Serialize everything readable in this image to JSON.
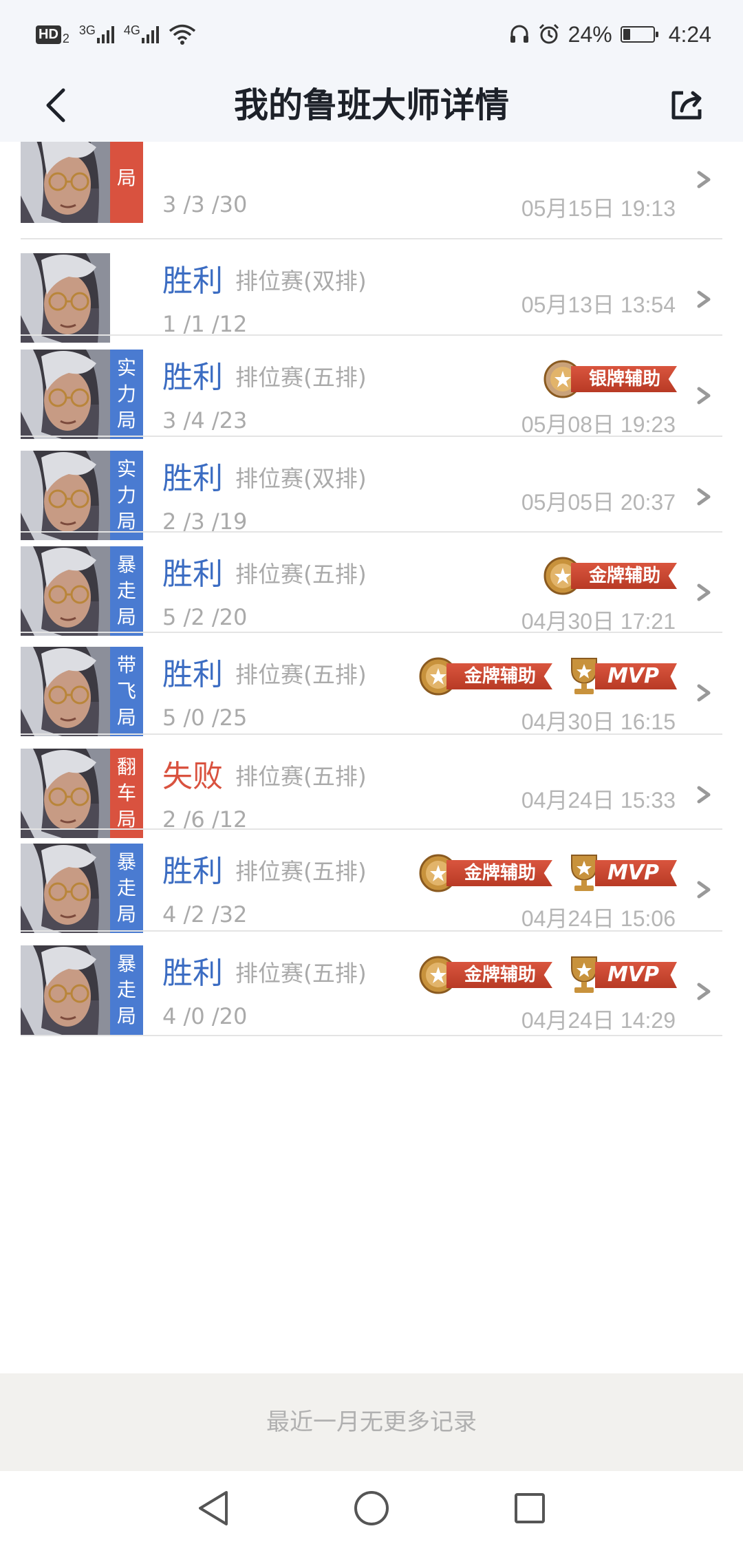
{
  "status_bar": {
    "hd_label": "HD",
    "hd_sub": "2",
    "net1": "3G",
    "net2": "4G",
    "battery_percent": "24%",
    "battery_level": 0.24,
    "time": "4:24"
  },
  "header": {
    "title": "我的鲁班大师详情"
  },
  "rows": [
    {
      "tag": "局",
      "tag_color": "red",
      "result": "",
      "result_type": "win",
      "mode": "",
      "kda": "3 /3 /30",
      "time": "05月15日 19:13",
      "badges": [],
      "partial": true
    },
    {
      "tag": "",
      "tag_color": "none",
      "result": "胜利",
      "result_type": "win",
      "mode": "排位赛(双排)",
      "kda": "1 /1 /12",
      "time": "05月13日 13:54",
      "badges": []
    },
    {
      "tag": "实力局",
      "tag_color": "blue",
      "result": "胜利",
      "result_type": "win",
      "mode": "排位赛(五排)",
      "kda": "3 /4 /23",
      "time": "05月08日 19:23",
      "badges": [
        {
          "kind": "medal",
          "label": "银牌辅助",
          "color": "#c9a27a"
        }
      ]
    },
    {
      "tag": "实力局",
      "tag_color": "blue",
      "result": "胜利",
      "result_type": "win",
      "mode": "排位赛(双排)",
      "kda": "2 /3 /19",
      "time": "05月05日 20:37",
      "badges": []
    },
    {
      "tag": "暴走局",
      "tag_color": "blue",
      "result": "胜利",
      "result_type": "win",
      "mode": "排位赛(五排)",
      "kda": "5 /2 /20",
      "time": "04月30日 17:21",
      "badges": [
        {
          "kind": "medal",
          "label": "金牌辅助",
          "color": "#c8923c"
        }
      ]
    },
    {
      "tag": "带飞局",
      "tag_color": "blue",
      "result": "胜利",
      "result_type": "win",
      "mode": "排位赛(五排)",
      "kda": "5 /0 /25",
      "time": "04月30日 16:15",
      "badges": [
        {
          "kind": "medal",
          "label": "金牌辅助",
          "color": "#c8923c"
        },
        {
          "kind": "mvp",
          "label": "MVP",
          "color": "#c8923c"
        }
      ]
    },
    {
      "tag": "翻车局",
      "tag_color": "red",
      "result": "失败",
      "result_type": "lose",
      "mode": "排位赛(五排)",
      "kda": "2 /6 /12",
      "time": "04月24日 15:33",
      "badges": []
    },
    {
      "tag": "暴走局",
      "tag_color": "blue",
      "result": "胜利",
      "result_type": "win",
      "mode": "排位赛(五排)",
      "kda": "4 /2 /32",
      "time": "04月24日 15:06",
      "badges": [
        {
          "kind": "medal",
          "label": "金牌辅助",
          "color": "#c8923c"
        },
        {
          "kind": "mvp",
          "label": "MVP",
          "color": "#c8923c"
        }
      ]
    },
    {
      "tag": "暴走局",
      "tag_color": "blue",
      "result": "胜利",
      "result_type": "win",
      "mode": "排位赛(五排)",
      "kda": "4 /0 /20",
      "time": "04月24日 14:29",
      "badges": [
        {
          "kind": "medal",
          "label": "金牌辅助",
          "color": "#c8923c"
        },
        {
          "kind": "mvp",
          "label": "MVP",
          "color": "#c8923c"
        }
      ]
    }
  ],
  "footer": {
    "note": "最近一月无更多记录"
  },
  "icons": {
    "back": "back-arrow-icon",
    "share": "share-icon",
    "row_arrow": "chevron-right-icon",
    "nav_back": "triangle-back-icon",
    "nav_home": "circle-home-icon",
    "nav_recent": "square-recent-icon"
  }
}
